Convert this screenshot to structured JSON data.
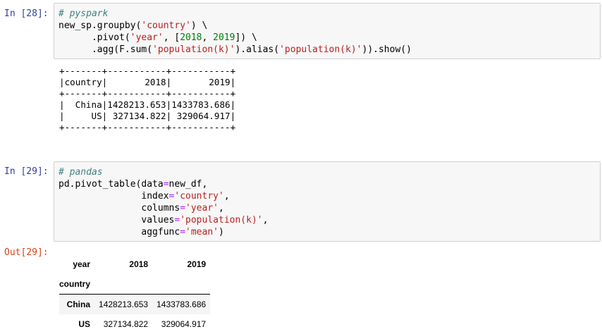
{
  "cells": [
    {
      "prompt": "In [28]:",
      "code": [
        [
          {
            "t": "# pyspark",
            "c": "cm"
          }
        ],
        [
          {
            "t": "new_sp.groupby("
          },
          {
            "t": "'country'",
            "c": "st"
          },
          {
            "t": ") \\"
          }
        ],
        [
          {
            "t": "      .pivot("
          },
          {
            "t": "'year'",
            "c": "st"
          },
          {
            "t": ", ["
          },
          {
            "t": "2018",
            "c": "nu"
          },
          {
            "t": ", "
          },
          {
            "t": "2019",
            "c": "nu"
          },
          {
            "t": "]) \\"
          }
        ],
        [
          {
            "t": "      .agg(F.sum("
          },
          {
            "t": "'population(k)'",
            "c": "st"
          },
          {
            "t": ").alias("
          },
          {
            "t": "'population(k)'",
            "c": "st"
          },
          {
            "t": ")).show()"
          }
        ]
      ],
      "output_lines": [
        "+-------+-----------+-----------+",
        "|country|       2018|       2019|",
        "+-------+-----------+-----------+",
        "|  China|1428213.653|1433783.686|",
        "|     US| 327134.822| 329064.917|",
        "+-------+-----------+-----------+"
      ]
    },
    {
      "prompt": "In [29]:",
      "code": [
        [
          {
            "t": "# pandas",
            "c": "cm"
          }
        ],
        [
          {
            "t": "pd.pivot_table(data"
          },
          {
            "t": "=",
            "c": "op"
          },
          {
            "t": "new_df,"
          }
        ],
        [
          {
            "t": "               index"
          },
          {
            "t": "=",
            "c": "op"
          },
          {
            "t": "'country'",
            "c": "st"
          },
          {
            "t": ","
          }
        ],
        [
          {
            "t": "               columns"
          },
          {
            "t": "=",
            "c": "op"
          },
          {
            "t": "'year'",
            "c": "st"
          },
          {
            "t": ","
          }
        ],
        [
          {
            "t": "               values"
          },
          {
            "t": "=",
            "c": "op"
          },
          {
            "t": "'population(k)'",
            "c": "st"
          },
          {
            "t": ","
          }
        ],
        [
          {
            "t": "               aggfunc"
          },
          {
            "t": "=",
            "c": "op"
          },
          {
            "t": "'mean'",
            "c": "st"
          },
          {
            "t": ")"
          }
        ]
      ],
      "out_prompt": "Out[29]:",
      "table": {
        "columns_name": "year",
        "columns": [
          "2018",
          "2019"
        ],
        "index_name": "country",
        "rows": [
          {
            "index": "China",
            "values": [
              "1428213.653",
              "1433783.686"
            ]
          },
          {
            "index": "US",
            "values": [
              "327134.822",
              "329064.917"
            ]
          }
        ]
      }
    }
  ]
}
